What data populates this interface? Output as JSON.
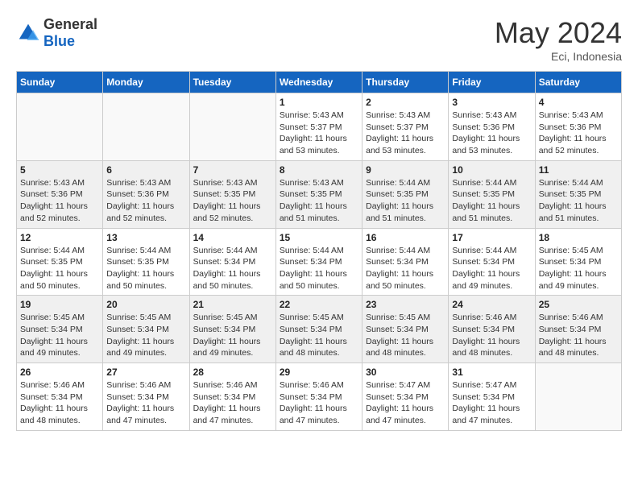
{
  "logo": {
    "general": "General",
    "blue": "Blue"
  },
  "title": {
    "month_year": "May 2024",
    "location": "Eci, Indonesia"
  },
  "weekdays": [
    "Sunday",
    "Monday",
    "Tuesday",
    "Wednesday",
    "Thursday",
    "Friday",
    "Saturday"
  ],
  "weeks": [
    [
      {
        "day": "",
        "info": ""
      },
      {
        "day": "",
        "info": ""
      },
      {
        "day": "",
        "info": ""
      },
      {
        "day": "1",
        "info": "Sunrise: 5:43 AM\nSunset: 5:37 PM\nDaylight: 11 hours\nand 53 minutes."
      },
      {
        "day": "2",
        "info": "Sunrise: 5:43 AM\nSunset: 5:37 PM\nDaylight: 11 hours\nand 53 minutes."
      },
      {
        "day": "3",
        "info": "Sunrise: 5:43 AM\nSunset: 5:36 PM\nDaylight: 11 hours\nand 53 minutes."
      },
      {
        "day": "4",
        "info": "Sunrise: 5:43 AM\nSunset: 5:36 PM\nDaylight: 11 hours\nand 52 minutes."
      }
    ],
    [
      {
        "day": "5",
        "info": "Sunrise: 5:43 AM\nSunset: 5:36 PM\nDaylight: 11 hours\nand 52 minutes."
      },
      {
        "day": "6",
        "info": "Sunrise: 5:43 AM\nSunset: 5:36 PM\nDaylight: 11 hours\nand 52 minutes."
      },
      {
        "day": "7",
        "info": "Sunrise: 5:43 AM\nSunset: 5:35 PM\nDaylight: 11 hours\nand 52 minutes."
      },
      {
        "day": "8",
        "info": "Sunrise: 5:43 AM\nSunset: 5:35 PM\nDaylight: 11 hours\nand 51 minutes."
      },
      {
        "day": "9",
        "info": "Sunrise: 5:44 AM\nSunset: 5:35 PM\nDaylight: 11 hours\nand 51 minutes."
      },
      {
        "day": "10",
        "info": "Sunrise: 5:44 AM\nSunset: 5:35 PM\nDaylight: 11 hours\nand 51 minutes."
      },
      {
        "day": "11",
        "info": "Sunrise: 5:44 AM\nSunset: 5:35 PM\nDaylight: 11 hours\nand 51 minutes."
      }
    ],
    [
      {
        "day": "12",
        "info": "Sunrise: 5:44 AM\nSunset: 5:35 PM\nDaylight: 11 hours\nand 50 minutes."
      },
      {
        "day": "13",
        "info": "Sunrise: 5:44 AM\nSunset: 5:35 PM\nDaylight: 11 hours\nand 50 minutes."
      },
      {
        "day": "14",
        "info": "Sunrise: 5:44 AM\nSunset: 5:34 PM\nDaylight: 11 hours\nand 50 minutes."
      },
      {
        "day": "15",
        "info": "Sunrise: 5:44 AM\nSunset: 5:34 PM\nDaylight: 11 hours\nand 50 minutes."
      },
      {
        "day": "16",
        "info": "Sunrise: 5:44 AM\nSunset: 5:34 PM\nDaylight: 11 hours\nand 50 minutes."
      },
      {
        "day": "17",
        "info": "Sunrise: 5:44 AM\nSunset: 5:34 PM\nDaylight: 11 hours\nand 49 minutes."
      },
      {
        "day": "18",
        "info": "Sunrise: 5:45 AM\nSunset: 5:34 PM\nDaylight: 11 hours\nand 49 minutes."
      }
    ],
    [
      {
        "day": "19",
        "info": "Sunrise: 5:45 AM\nSunset: 5:34 PM\nDaylight: 11 hours\nand 49 minutes."
      },
      {
        "day": "20",
        "info": "Sunrise: 5:45 AM\nSunset: 5:34 PM\nDaylight: 11 hours\nand 49 minutes."
      },
      {
        "day": "21",
        "info": "Sunrise: 5:45 AM\nSunset: 5:34 PM\nDaylight: 11 hours\nand 49 minutes."
      },
      {
        "day": "22",
        "info": "Sunrise: 5:45 AM\nSunset: 5:34 PM\nDaylight: 11 hours\nand 48 minutes."
      },
      {
        "day": "23",
        "info": "Sunrise: 5:45 AM\nSunset: 5:34 PM\nDaylight: 11 hours\nand 48 minutes."
      },
      {
        "day": "24",
        "info": "Sunrise: 5:46 AM\nSunset: 5:34 PM\nDaylight: 11 hours\nand 48 minutes."
      },
      {
        "day": "25",
        "info": "Sunrise: 5:46 AM\nSunset: 5:34 PM\nDaylight: 11 hours\nand 48 minutes."
      }
    ],
    [
      {
        "day": "26",
        "info": "Sunrise: 5:46 AM\nSunset: 5:34 PM\nDaylight: 11 hours\nand 48 minutes."
      },
      {
        "day": "27",
        "info": "Sunrise: 5:46 AM\nSunset: 5:34 PM\nDaylight: 11 hours\nand 47 minutes."
      },
      {
        "day": "28",
        "info": "Sunrise: 5:46 AM\nSunset: 5:34 PM\nDaylight: 11 hours\nand 47 minutes."
      },
      {
        "day": "29",
        "info": "Sunrise: 5:46 AM\nSunset: 5:34 PM\nDaylight: 11 hours\nand 47 minutes."
      },
      {
        "day": "30",
        "info": "Sunrise: 5:47 AM\nSunset: 5:34 PM\nDaylight: 11 hours\nand 47 minutes."
      },
      {
        "day": "31",
        "info": "Sunrise: 5:47 AM\nSunset: 5:34 PM\nDaylight: 11 hours\nand 47 minutes."
      },
      {
        "day": "",
        "info": ""
      }
    ]
  ]
}
